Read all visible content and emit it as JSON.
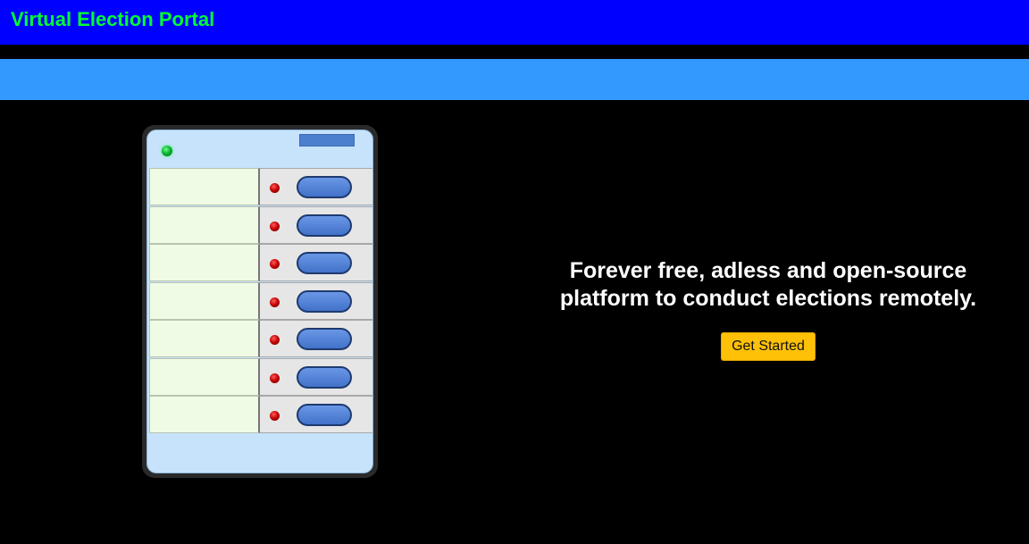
{
  "header": {
    "brand": "Virtual Election Portal"
  },
  "hero": {
    "line1": "Forever free, adless and open-source",
    "line2": "platform to conduct elections remotely.",
    "cta_label": "Get Started"
  },
  "evm": {
    "rows": [
      {
        "candidate": ""
      },
      {
        "candidate": ""
      },
      {
        "candidate": ""
      },
      {
        "candidate": ""
      },
      {
        "candidate": ""
      },
      {
        "candidate": ""
      },
      {
        "candidate": ""
      }
    ]
  },
  "colors": {
    "topbar": "#0000ff",
    "brand_text": "#00ff33",
    "subbar": "#3399ff",
    "background": "#000000",
    "cta": "#ffc107"
  }
}
